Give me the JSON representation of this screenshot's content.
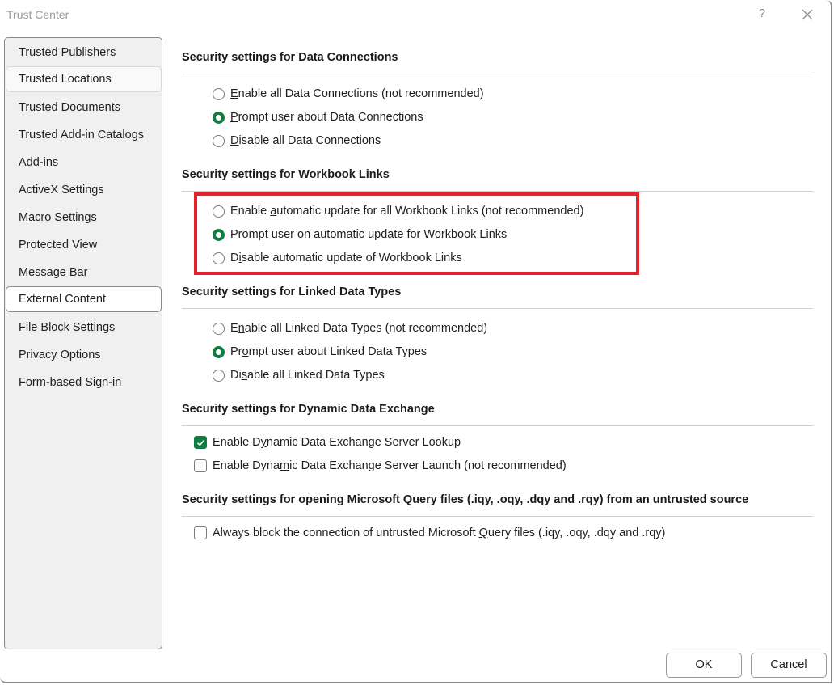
{
  "window": {
    "title": "Trust Center",
    "help_label": "?",
    "close_icon": "close-icon"
  },
  "sidebar": {
    "items": [
      {
        "label": "Trusted Publishers",
        "state": "normal"
      },
      {
        "label": "Trusted Locations",
        "state": "hover"
      },
      {
        "label": "Trusted Documents",
        "state": "normal"
      },
      {
        "label": "Trusted Add-in Catalogs",
        "state": "normal"
      },
      {
        "label": "Add-ins",
        "state": "normal"
      },
      {
        "label": "ActiveX Settings",
        "state": "normal"
      },
      {
        "label": "Macro Settings",
        "state": "normal"
      },
      {
        "label": "Protected View",
        "state": "normal"
      },
      {
        "label": "Message Bar",
        "state": "normal"
      },
      {
        "label": "External Content",
        "state": "selected"
      },
      {
        "label": "File Block Settings",
        "state": "normal"
      },
      {
        "label": "Privacy Options",
        "state": "normal"
      },
      {
        "label": "Form-based Sign-in",
        "state": "normal"
      }
    ]
  },
  "sections": {
    "data_connections": {
      "title": "Security settings for Data Connections",
      "options": [
        {
          "pre": "",
          "key": "E",
          "post": "nable all Data Connections (not recommended)",
          "selected": false
        },
        {
          "pre": "",
          "key": "P",
          "post": "rompt user about Data Connections",
          "selected": true
        },
        {
          "pre": "",
          "key": "D",
          "post": "isable all Data Connections",
          "selected": false
        }
      ]
    },
    "workbook_links": {
      "title": "Security settings for Workbook Links",
      "highlighted": true,
      "highlight_color": "#e8202a",
      "options": [
        {
          "pre": "Enable ",
          "key": "a",
          "post": "utomatic update for all Workbook Links (not recommended)",
          "selected": false
        },
        {
          "pre": "P",
          "key": "r",
          "post": "ompt user on automatic update for Workbook Links",
          "selected": true
        },
        {
          "pre": "D",
          "key": "i",
          "post": "sable automatic update of Workbook Links",
          "selected": false
        }
      ]
    },
    "linked_data_types": {
      "title": "Security settings for Linked Data Types",
      "options": [
        {
          "pre": "E",
          "key": "n",
          "post": "able all Linked Data Types (not recommended)",
          "selected": false
        },
        {
          "pre": "Pr",
          "key": "o",
          "post": "mpt user about Linked Data Types",
          "selected": true
        },
        {
          "pre": "Di",
          "key": "s",
          "post": "able all Linked Data Types",
          "selected": false
        }
      ]
    },
    "dde": {
      "title": "Security settings for Dynamic Data Exchange",
      "options": [
        {
          "pre": "Enable D",
          "key": "y",
          "post": "namic Data Exchange Server Lookup",
          "checked": true
        },
        {
          "pre": "Enable Dyna",
          "key": "m",
          "post": "ic Data Exchange Server Launch (not recommended)",
          "checked": false
        }
      ]
    },
    "query_files": {
      "title": "Security settings for opening  Microsoft Query files (.iqy, .oqy, .dqy and .rqy) from an untrusted source",
      "options": [
        {
          "pre": "Always block the connection of untrusted Microsoft ",
          "key": "Q",
          "post": "uery files (.iqy, .oqy, .dqy and .rqy)",
          "checked": false
        }
      ]
    }
  },
  "accent_color": "#107c41",
  "footer": {
    "ok_label": "OK",
    "cancel_label": "Cancel"
  }
}
